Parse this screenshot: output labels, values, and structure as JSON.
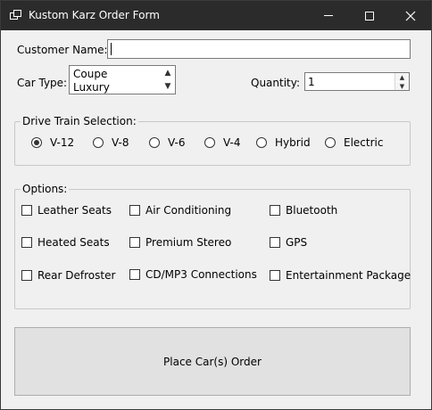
{
  "window": {
    "title": "Kustom Karz Order Form"
  },
  "customer": {
    "label": "Customer Name:",
    "value": ""
  },
  "car_type": {
    "label": "Car Type:",
    "options": [
      "Coupe",
      "Luxury"
    ]
  },
  "quantity": {
    "label": "Quantity:",
    "value": "1"
  },
  "drive_train": {
    "title": "Drive Train Selection:",
    "options": [
      "V-12",
      "V-8",
      "V-6",
      "V-4",
      "Hybrid",
      "Electric"
    ],
    "selected": "V-12"
  },
  "options": {
    "title": "Options:",
    "items": [
      "Leather Seats",
      "Air Conditioning",
      "Bluetooth",
      "Heated Seats",
      "Premium Stereo",
      "GPS",
      "Rear Defroster",
      "CD/MP3 Connections",
      "Entertainment Package"
    ]
  },
  "order_button": {
    "label": "Place Car(s) Order"
  }
}
